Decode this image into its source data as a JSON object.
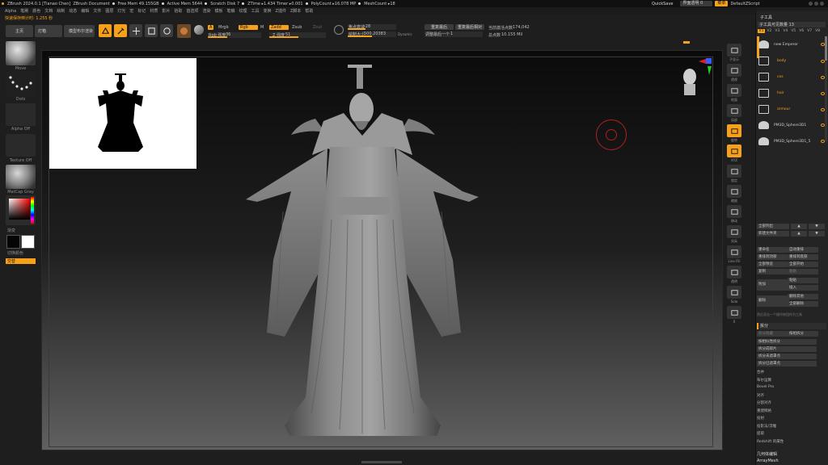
{
  "title_bar": {
    "app": "ZBrush 2024.0.1 [Tianao Chen]",
    "document": "ZBrush Document",
    "stats": [
      "Free Mem 49.155GB",
      "Active Mem 5644",
      "Scratch Disk 7",
      "ZTime ▸1.434 Timer ▸0.001",
      "PolyCount ▸16.078 MP",
      "MeshCount ▸18"
    ],
    "quicksave": "QuickSave",
    "transparency": "界面透明 0",
    "menus_btn": "菜单",
    "script": "DefaultZScript"
  },
  "menu_bar": [
    "Alpha",
    "笔刷",
    "颜色",
    "文档",
    "绘制",
    "动态",
    "编辑",
    "文件",
    "图层",
    "灯光",
    "宏",
    "标记",
    "材质",
    "影片",
    "拾取",
    "首选项",
    "渲染",
    "模板",
    "笔触",
    "纹理",
    "工具",
    "变换",
    "Z插件",
    "Z脚本",
    "帮助"
  ],
  "info_line": "快速保存倒计时: 1.255 秒",
  "top_shelf": {
    "home": "主页",
    "lightbox": "灯箱",
    "live_boolean": "模型布尔渲染",
    "tools": [
      {
        "label": "Edit",
        "icon": "edit-icon",
        "on": true
      },
      {
        "label": "Draw",
        "icon": "draw-icon",
        "on": true
      },
      {
        "label": "Move",
        "icon": "move-icon",
        "on": false
      },
      {
        "label": "Scale",
        "icon": "scale-icon",
        "on": false
      },
      {
        "label": "Rotate",
        "icon": "rotate-icon",
        "on": false
      }
    ],
    "a_label": "A",
    "mrgb": "Mrgb",
    "rgb": "Rgb",
    "m": "M",
    "rgb_intensity_label": "Rgb 强度",
    "rgb_intensity": 36,
    "zadd": "Zadd",
    "zsub": "Zsub",
    "zcut": "Zcut",
    "z_intensity_label": "Z 强度",
    "z_intensity": 51,
    "focal_shift_label": "焦点衰减",
    "focal_shift": -28,
    "draw_size_label": "绘制大小",
    "draw_size": "500.20383",
    "dynamic": "Dynamic",
    "rebuild_partial": "重复最后",
    "rebuild_relative": "重复最后相对",
    "adjust_last_label": "调整最后一个",
    "adjust_last": 1,
    "active_points_label": "当前激活点数",
    "active_points": "174,042",
    "total_points_label": "总点数",
    "total_points": "10.155 Mil"
  },
  "left_tray": {
    "brush": "Move",
    "stroke": "Dots",
    "alpha": "Alpha Off",
    "texture": "Texture Off",
    "material": "MatCap Gray",
    "gradient": "渐变",
    "switch_color": "切换颜色",
    "alternate": "交替"
  },
  "right_shelf": [
    {
      "label": "子显示",
      "icon": "subdisplay-icon",
      "on": false
    },
    {
      "label": "透视",
      "icon": "persp-icon",
      "on": false
    },
    {
      "label": "地面",
      "icon": "floor-icon",
      "on": false
    },
    {
      "label": "局部",
      "icon": "local-icon",
      "on": false
    },
    {
      "label": "旋转",
      "icon": "rotate-xyz-icon",
      "on": true
    },
    {
      "label": "XYZ",
      "icon": "axis-icon",
      "on": true
    },
    {
      "label": "锁定",
      "icon": "lock-icon",
      "on": false
    },
    {
      "label": "缩放",
      "icon": "zoom-icon",
      "on": false
    },
    {
      "label": "移动",
      "icon": "move-view-icon",
      "on": false
    },
    {
      "label": "实际",
      "icon": "actual-icon",
      "on": false
    },
    {
      "label": "Line Fill",
      "icon": "linefill-icon",
      "on": false
    },
    {
      "label": "透明",
      "icon": "transp-icon",
      "on": false
    },
    {
      "label": "Solo",
      "icon": "solo-icon",
      "on": false
    },
    {
      "label": "X",
      "icon": "xpose-icon",
      "on": false
    }
  ],
  "right_panel": {
    "header": "子工具",
    "visible_count": "子工具可见数量 13",
    "version_tabs": [
      "V1",
      "V2",
      "V3",
      "V4",
      "V5",
      "V6",
      "V7",
      "V8"
    ],
    "subtools": [
      {
        "name": "new Emperor",
        "type": "mesh"
      },
      {
        "name": "body",
        "type": "folder"
      },
      {
        "name": "cos",
        "type": "folder"
      },
      {
        "name": "hair",
        "type": "folder"
      },
      {
        "name": "armour",
        "type": "folder"
      },
      {
        "name": "PM3D_Sphere3D1",
        "type": "mesh"
      },
      {
        "name": "PM3D_Sphere3D1_5",
        "type": "mesh"
      }
    ],
    "list_all": "全部列出",
    "new_folder": "新建文件夹",
    "rows_a": [
      [
        "重命名",
        "自动重排"
      ],
      [
        "重排到顶部",
        "重排到底部"
      ],
      [
        "全部预览",
        "全部开始"
      ],
      [
        "复制",
        "粘贴"
      ]
    ],
    "append": "附加",
    "insert": "插入",
    "delete": "删除",
    "delete_other": "删除其他",
    "delete_all": "全部删除",
    "delete_hint": "然后双击一个操作按钮作为工具",
    "split_header": "拆分",
    "split_hidden": "拆分隐藏",
    "groups_split": "按组拆分",
    "split_rows": [
      "按相似性拆分",
      "拆分成碎片",
      "拆分未遮罩点",
      "拆分已遮罩点"
    ],
    "merge_rows": [
      "合并",
      "布尔运算",
      "Bevel Pro",
      "对齐",
      "分割对齐",
      "重建网格",
      "投射",
      "投影法/浮雕",
      "提取",
      "Redshift 的属性"
    ],
    "geometry_edit": "几何体编辑",
    "array_mesh": "ArrayMesh"
  }
}
